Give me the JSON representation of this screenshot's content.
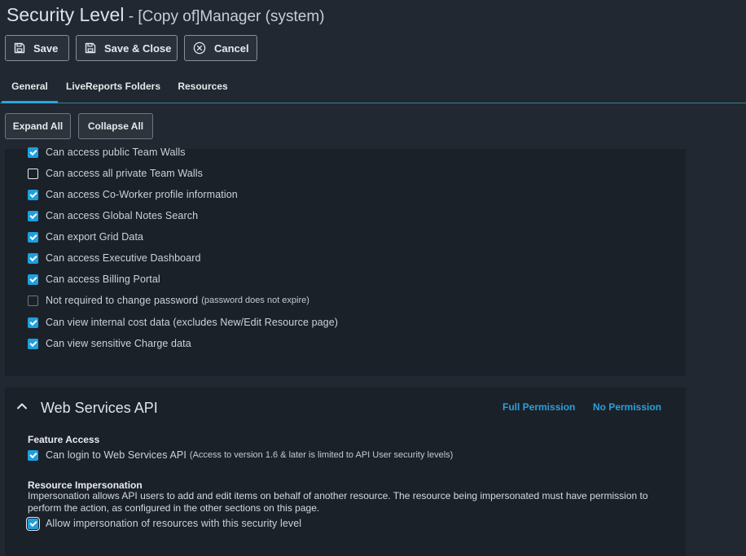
{
  "header": {
    "title": "Security Level",
    "subtitle": " - [Copy of]Manager (system)"
  },
  "toolbar": {
    "save_label": "Save",
    "save_close_label": "Save & Close",
    "cancel_label": "Cancel",
    "save_icon": "floppy-disk-icon",
    "save_close_icon": "floppy-disk-icon",
    "cancel_icon": "circle-x-icon"
  },
  "tabs": [
    {
      "label": "General",
      "active": true
    },
    {
      "label": "LiveReports Folders",
      "active": false
    },
    {
      "label": "Resources",
      "active": false
    }
  ],
  "expand_all_label": "Expand All",
  "collapse_all_label": "Collapse All",
  "permissions": [
    {
      "label": "Can access public Team Walls",
      "note": "",
      "checked": true
    },
    {
      "label": "Can access all private Team Walls",
      "note": "",
      "checked": false
    },
    {
      "label": "Can access Co-Worker profile information",
      "note": "",
      "checked": true
    },
    {
      "label": "Can access Global Notes Search",
      "note": "",
      "checked": true
    },
    {
      "label": "Can export Grid Data",
      "note": "",
      "checked": true
    },
    {
      "label": "Can access Executive Dashboard",
      "note": "",
      "checked": true
    },
    {
      "label": "Can access Billing Portal",
      "note": "",
      "checked": true
    },
    {
      "label": "Not required to change password",
      "note": "(password does not expire)",
      "checked": false
    },
    {
      "label": "Can view internal cost data (excludes New/Edit Resource page)",
      "note": "",
      "checked": true
    },
    {
      "label": "Can view sensitive Charge data",
      "note": "",
      "checked": true
    }
  ],
  "web_services": {
    "title": "Web Services API",
    "collapse_icon": "chevron-up-icon",
    "full_permission_label": "Full Permission",
    "no_permission_label": "No Permission",
    "feature_access_heading": "Feature Access",
    "login_label": "Can login to Web Services API",
    "login_note": "(Access to version 1.6 & later is limited to API User security levels)",
    "login_checked": true,
    "impersonation_heading": "Resource Impersonation",
    "impersonation_desc": "Impersonation allows API users to add and edit items on behalf of another resource. The resource being impersonated must have permission to perform the action, as configured in the other sections on this page.",
    "impersonation_label": "Allow impersonation of resources with this security level",
    "impersonation_checked": true
  },
  "colors": {
    "background": "#212831",
    "panel": "#1b2129",
    "accent": "#1e9fde",
    "link": "#2aa1db"
  }
}
